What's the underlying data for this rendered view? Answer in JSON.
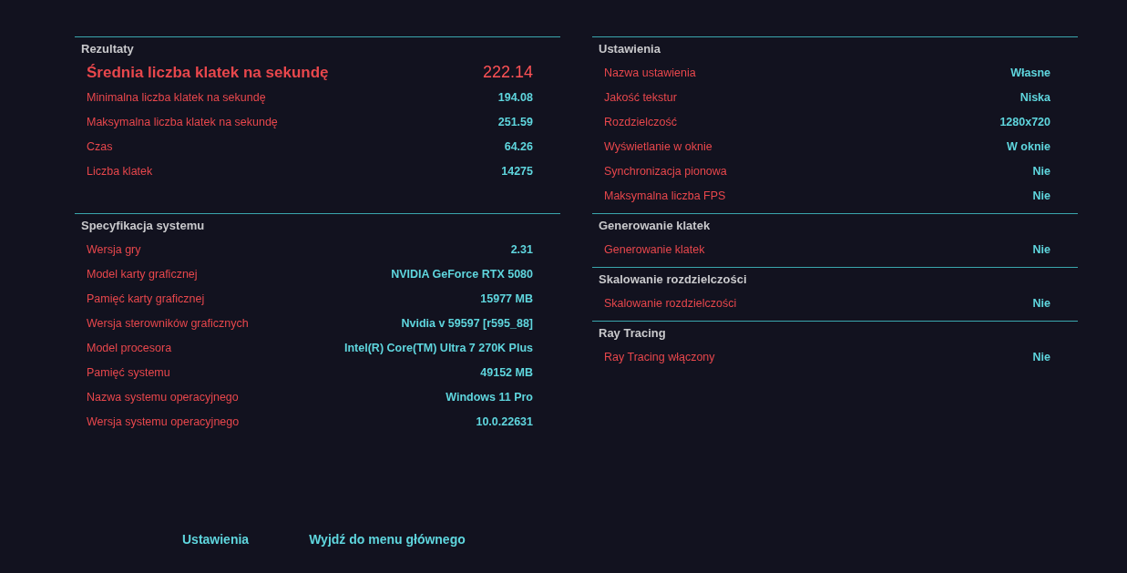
{
  "results": {
    "title": "Rezultaty",
    "rows": [
      {
        "kind": "highlight",
        "label": "Średnia liczba klatek na sekundę",
        "value": "222.14"
      },
      {
        "kind": "normal",
        "label": "Minimalna liczba klatek na sekundę",
        "value": "194.08"
      },
      {
        "kind": "normal",
        "label": "Maksymalna liczba klatek na sekundę",
        "value": "251.59"
      },
      {
        "kind": "normal",
        "label": "Czas",
        "value": "64.26"
      },
      {
        "kind": "normal",
        "label": "Liczba klatek",
        "value": "14275"
      }
    ]
  },
  "system_spec": {
    "title": "Specyfikacja systemu",
    "rows": [
      {
        "kind": "normal",
        "label": "Wersja gry",
        "value": "2.31"
      },
      {
        "kind": "normal",
        "label": "Model karty graficznej",
        "value": "NVIDIA GeForce RTX 5080"
      },
      {
        "kind": "normal",
        "label": "Pamięć karty graficznej",
        "value": "15977 MB"
      },
      {
        "kind": "normal",
        "label": "Wersja sterowników graficznych",
        "value": "Nvidia v 59597 [r595_88]"
      },
      {
        "kind": "normal",
        "label": "Model procesora",
        "value": "Intel(R) Core(TM) Ultra 7 270K Plus"
      },
      {
        "kind": "normal",
        "label": "Pamięć systemu",
        "value": "49152 MB"
      },
      {
        "kind": "normal",
        "label": "Nazwa systemu operacyjnego",
        "value": "Windows 11 Pro"
      },
      {
        "kind": "normal",
        "label": "Wersja systemu operacyjnego",
        "value": "10.0.22631"
      }
    ]
  },
  "settings_sections": [
    {
      "title": "Ustawienia",
      "rows": [
        {
          "kind": "normal",
          "label": "Nazwa ustawienia",
          "value": "Własne"
        },
        {
          "kind": "normal",
          "label": "Jakość tekstur",
          "value": "Niska"
        },
        {
          "kind": "normal",
          "label": "Rozdzielczość",
          "value": "1280x720"
        },
        {
          "kind": "normal",
          "label": "Wyświetlanie w oknie",
          "value": "W oknie"
        },
        {
          "kind": "normal",
          "label": "Synchronizacja pionowa",
          "value": "Nie"
        },
        {
          "kind": "normal",
          "label": "Maksymalna liczba FPS",
          "value": "Nie"
        }
      ]
    },
    {
      "title": "Generowanie klatek",
      "rows": [
        {
          "kind": "normal",
          "label": "Generowanie klatek",
          "value": "Nie"
        }
      ]
    },
    {
      "title": "Skalowanie rozdzielczości",
      "rows": [
        {
          "kind": "normal",
          "label": "Skalowanie rozdzielczości",
          "value": "Nie"
        }
      ]
    },
    {
      "title": "Ray Tracing",
      "rows": [
        {
          "kind": "normal",
          "label": "Ray Tracing włączony",
          "value": "Nie"
        }
      ]
    }
  ],
  "buttons": [
    {
      "label": "Ustawienia"
    },
    {
      "label": "Wyjdź do menu głównego"
    }
  ]
}
